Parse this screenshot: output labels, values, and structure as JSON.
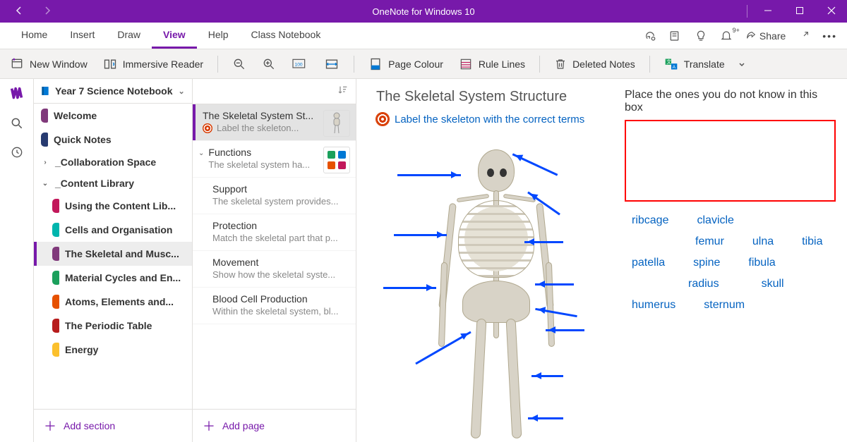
{
  "window": {
    "title": "OneNote for Windows 10",
    "share_label": "Share",
    "notification_badge": "9+"
  },
  "tabs": {
    "home": "Home",
    "insert": "Insert",
    "draw": "Draw",
    "view": "View",
    "help": "Help",
    "class_notebook": "Class Notebook",
    "selected": "view"
  },
  "ribbon": {
    "new_window": "New Window",
    "immersive_reader": "Immersive Reader",
    "page_colour": "Page Colour",
    "rule_lines": "Rule Lines",
    "deleted_notes": "Deleted Notes",
    "translate": "Translate"
  },
  "notebook": {
    "name": "Year 7 Science Notebook",
    "sections": [
      {
        "label": "Welcome",
        "color": "#80397B",
        "indent": 0,
        "type": "section"
      },
      {
        "label": "Quick Notes",
        "color": "#273A70",
        "indent": 0,
        "type": "section"
      },
      {
        "label": "_Collaboration Space",
        "indent": 0,
        "type": "group",
        "expanded": false
      },
      {
        "label": "_Content Library",
        "indent": 0,
        "type": "group",
        "expanded": true
      },
      {
        "label": "Using the Content Lib...",
        "color": "#C2185B",
        "indent": 1,
        "type": "section"
      },
      {
        "label": "Cells and Organisation",
        "color": "#00B5AD",
        "indent": 1,
        "type": "section"
      },
      {
        "label": "The Skeletal and Musc...",
        "color": "#80397B",
        "indent": 1,
        "type": "section",
        "selected": true
      },
      {
        "label": "Material Cycles and En...",
        "color": "#1BA05C",
        "indent": 1,
        "type": "section"
      },
      {
        "label": "Atoms, Elements and...",
        "color": "#E65100",
        "indent": 1,
        "type": "section"
      },
      {
        "label": "The Periodic Table",
        "color": "#B71C1C",
        "indent": 1,
        "type": "section"
      },
      {
        "label": "Energy",
        "color": "#FBC02D",
        "indent": 1,
        "type": "section"
      }
    ],
    "add_section_label": "Add section"
  },
  "pagelist": {
    "pages": [
      {
        "title": "The Skeletal System St...",
        "preview": "Label the skeleton...",
        "selected": true,
        "has_target_icon": true,
        "thumb": "skeleton"
      },
      {
        "title": "Functions",
        "preview": "The skeletal system ha...",
        "collapse_chev": true,
        "thumb": "blocks"
      },
      {
        "title": "Support",
        "preview": "The skeletal system provides...",
        "sub": true
      },
      {
        "title": "Protection",
        "preview": "Match the skeletal part that p...",
        "sub": true
      },
      {
        "title": "Movement",
        "preview": "Show how the skeletal syste...",
        "sub": true
      },
      {
        "title": "Blood Cell Production",
        "preview": "Within the skeletal system, bl...",
        "sub": true
      }
    ],
    "add_page_label": "Add page"
  },
  "content": {
    "page_title": "The Skeletal System Structure",
    "instruction": "Label the skeleton with the correct terms",
    "exercise_prompt": "Place the ones you do not know in this box",
    "word_bank": [
      "ribcage",
      "clavicle",
      "femur",
      "ulna",
      "tibia",
      "patella",
      "spine",
      "fibula",
      "radius",
      "skull",
      "humerus",
      "sternum"
    ]
  }
}
